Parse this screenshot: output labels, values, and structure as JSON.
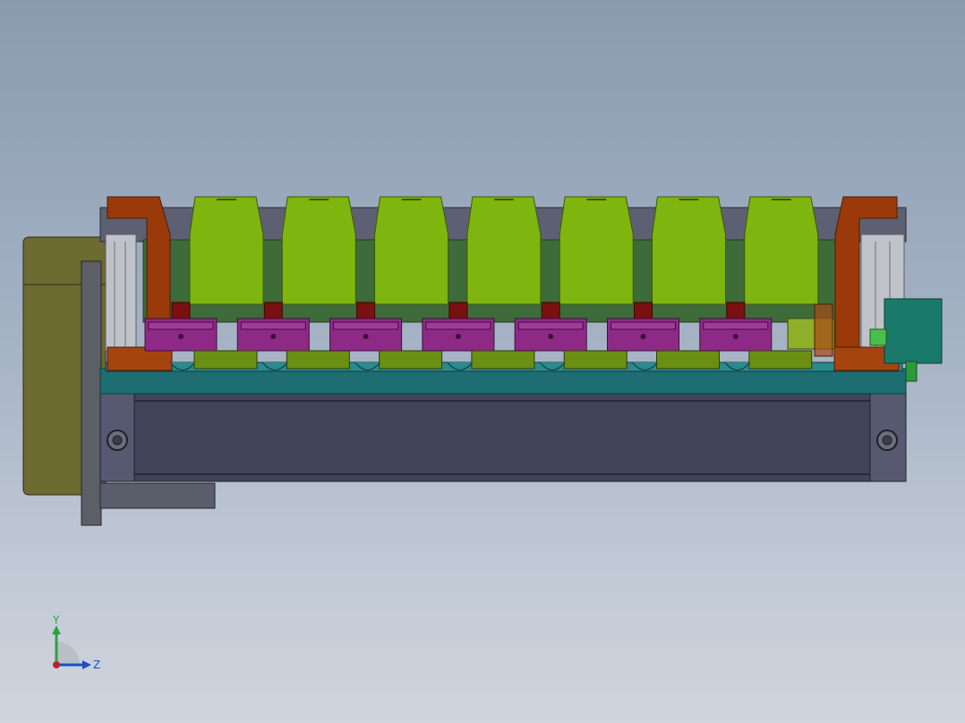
{
  "viewport": {
    "background_top": "#8a9bb0",
    "background_bottom": "#cfd5dd"
  },
  "triad": {
    "y_label": "Y",
    "z_label": "Z",
    "y_color": "#2ea043",
    "z_color": "#1f4fbf",
    "x_color": "#c0202a"
  },
  "model": {
    "station_count": 7,
    "colors": {
      "motor": "#6d6a32",
      "frame": "#4a4d63",
      "base_plate": "#1e6d72",
      "end_block": "#9a3a0a",
      "green_block": "#7fb50f",
      "magenta_clamp": "#8e2a86",
      "olive_pad": "#6a8f12",
      "connector": "#1a7a6a"
    }
  }
}
